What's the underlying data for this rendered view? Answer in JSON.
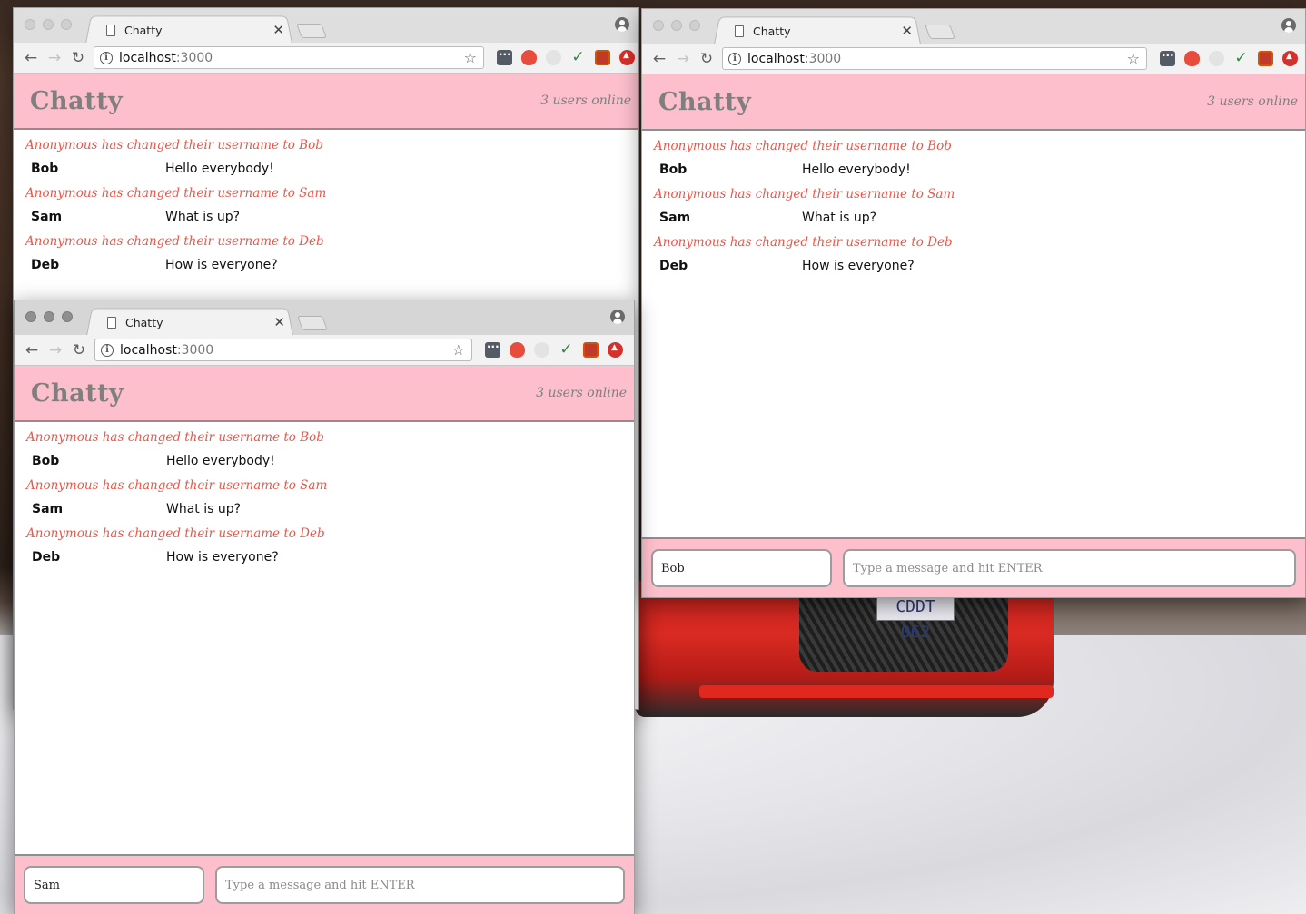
{
  "desktop": {
    "license_plate": "CDDT 062"
  },
  "windows": [
    {
      "id": "top_left",
      "tab_title": "Chatty",
      "url_host": "localhost",
      "url_port": ":3000",
      "app": {
        "brand": "Chatty",
        "users_online": "3 users online",
        "messages": [
          {
            "kind": "notification",
            "text": "Anonymous has changed their username to Bob"
          },
          {
            "kind": "message",
            "user": "Bob",
            "text": "Hello everybody!"
          },
          {
            "kind": "notification",
            "text": "Anonymous has changed their username to Sam"
          },
          {
            "kind": "message",
            "user": "Sam",
            "text": "What is up?"
          },
          {
            "kind": "notification",
            "text": "Anonymous has changed their username to Deb"
          },
          {
            "kind": "message",
            "user": "Deb",
            "text": "How is everyone?"
          }
        ]
      }
    },
    {
      "id": "right",
      "tab_title": "Chatty",
      "url_host": "localhost",
      "url_port": ":3000",
      "app": {
        "brand": "Chatty",
        "users_online": "3 users online",
        "messages": [
          {
            "kind": "notification",
            "text": "Anonymous has changed their username to Bob"
          },
          {
            "kind": "message",
            "user": "Bob",
            "text": "Hello everybody!"
          },
          {
            "kind": "notification",
            "text": "Anonymous has changed their username to Sam"
          },
          {
            "kind": "message",
            "user": "Sam",
            "text": "What is up?"
          },
          {
            "kind": "notification",
            "text": "Anonymous has changed their username to Deb"
          },
          {
            "kind": "message",
            "user": "Deb",
            "text": "How is everyone?"
          }
        ],
        "username_value": "Bob",
        "message_placeholder": "Type a message and hit ENTER"
      }
    },
    {
      "id": "front",
      "tab_title": "Chatty",
      "url_host": "localhost",
      "url_port": ":3000",
      "app": {
        "brand": "Chatty",
        "users_online": "3 users online",
        "messages": [
          {
            "kind": "notification",
            "text": "Anonymous has changed their username to Bob"
          },
          {
            "kind": "message",
            "user": "Bob",
            "text": "Hello everybody!"
          },
          {
            "kind": "notification",
            "text": "Anonymous has changed their username to Sam"
          },
          {
            "kind": "message",
            "user": "Sam",
            "text": "What is up?"
          },
          {
            "kind": "notification",
            "text": "Anonymous has changed their username to Deb"
          },
          {
            "kind": "message",
            "user": "Deb",
            "text": "How is everyone?"
          }
        ],
        "username_value": "Sam",
        "message_placeholder": "Type a message and hit ENTER"
      }
    }
  ],
  "colors": {
    "navbar_bg": "#fcbfcb",
    "notification_text": "#e8574a",
    "brand_text": "#7f7f7f"
  }
}
